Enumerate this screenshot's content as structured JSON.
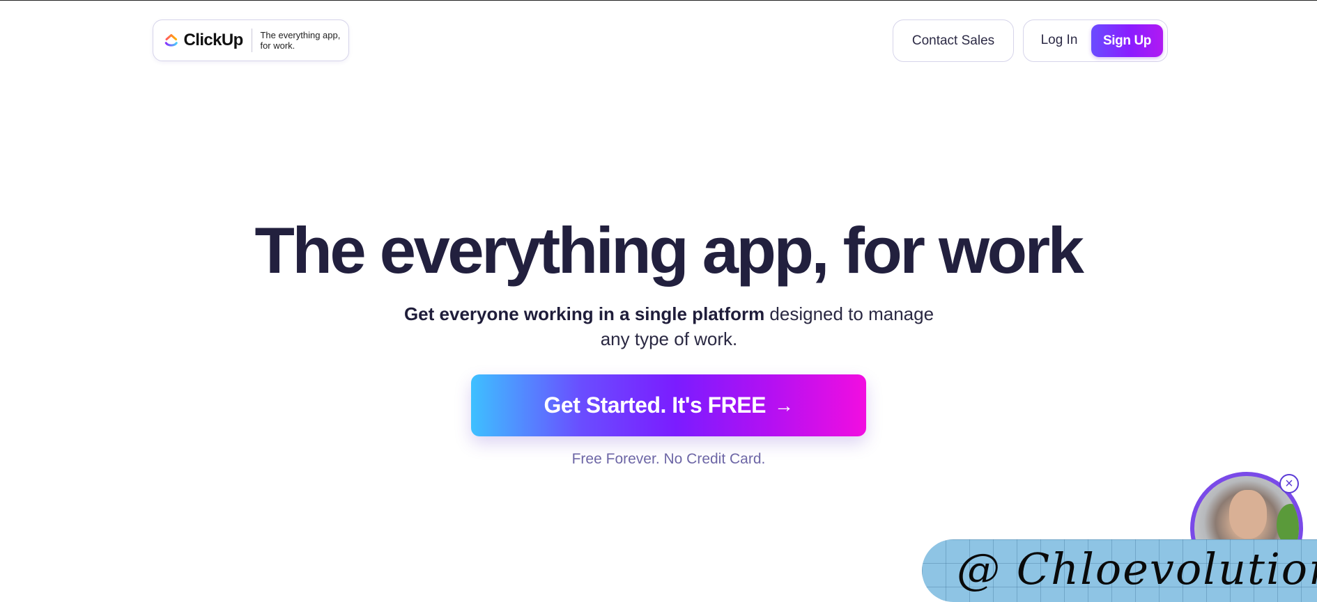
{
  "header": {
    "logo_text": "ClickUp",
    "tagline": "The everything app, for work.",
    "contact_sales_label": "Contact Sales",
    "login_label": "Log In",
    "signup_label": "Sign Up"
  },
  "hero": {
    "title": "The everything app, for work",
    "subtitle_bold": "Get everyone working in a single platform",
    "subtitle_rest": " designed to manage any type of work.",
    "cta_label": "Get Started. It's FREE",
    "cta_icon": "arrow-right-icon",
    "cta_note": "Free Forever. No Credit Card."
  },
  "video_widget": {
    "close_icon": "close-icon"
  },
  "overlay": {
    "watermark_text": "@ Chloevolution"
  },
  "colors": {
    "brand_gradient_start": "#3ec0ff",
    "brand_gradient_mid": "#7b1cff",
    "brand_gradient_end": "#f20ee0",
    "text_dark": "#22203e",
    "note_text": "#6d66a6"
  }
}
